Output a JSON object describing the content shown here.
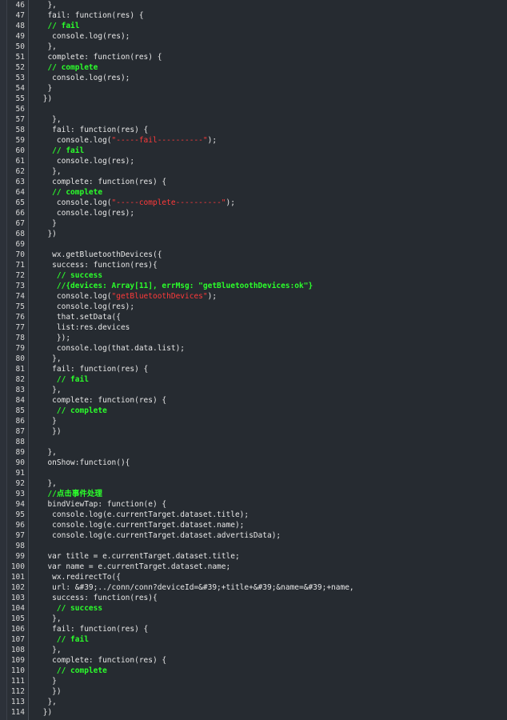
{
  "editor": {
    "lines": [
      {
        "n": "46",
        "segments": [
          {
            "t": "  },",
            "k": "plain"
          }
        ]
      },
      {
        "n": "47",
        "segments": [
          {
            "t": "  fail: function(res) {",
            "k": "plain"
          }
        ]
      },
      {
        "n": "48",
        "segments": [
          {
            "t": "  // fail",
            "k": "cm"
          }
        ]
      },
      {
        "n": "49",
        "segments": [
          {
            "t": "   console.log(res);",
            "k": "plain"
          }
        ]
      },
      {
        "n": "50",
        "segments": [
          {
            "t": "  },",
            "k": "plain"
          }
        ]
      },
      {
        "n": "51",
        "segments": [
          {
            "t": "  complete: function(res) {",
            "k": "plain"
          }
        ]
      },
      {
        "n": "52",
        "segments": [
          {
            "t": "  // complete",
            "k": "cm"
          }
        ]
      },
      {
        "n": "53",
        "segments": [
          {
            "t": "   console.log(res);",
            "k": "plain"
          }
        ]
      },
      {
        "n": "54",
        "segments": [
          {
            "t": "  }",
            "k": "plain"
          }
        ]
      },
      {
        "n": "55",
        "segments": [
          {
            "t": " })",
            "k": "plain"
          }
        ]
      },
      {
        "n": "56",
        "segments": [
          {
            "t": "",
            "k": "plain"
          }
        ]
      },
      {
        "n": "57",
        "segments": [
          {
            "t": "   },",
            "k": "plain"
          }
        ]
      },
      {
        "n": "58",
        "segments": [
          {
            "t": "   fail: function(res) {",
            "k": "plain"
          }
        ]
      },
      {
        "n": "59",
        "segments": [
          {
            "t": "    console.log(",
            "k": "plain"
          },
          {
            "t": "\"-----fail----------\"",
            "k": "str"
          },
          {
            "t": ");",
            "k": "plain"
          }
        ]
      },
      {
        "n": "60",
        "segments": [
          {
            "t": "   // fail",
            "k": "cm"
          }
        ]
      },
      {
        "n": "61",
        "segments": [
          {
            "t": "    console.log(res);",
            "k": "plain"
          }
        ]
      },
      {
        "n": "62",
        "segments": [
          {
            "t": "   },",
            "k": "plain"
          }
        ]
      },
      {
        "n": "63",
        "segments": [
          {
            "t": "   complete: function(res) {",
            "k": "plain"
          }
        ]
      },
      {
        "n": "64",
        "segments": [
          {
            "t": "   // complete",
            "k": "cm"
          }
        ]
      },
      {
        "n": "65",
        "segments": [
          {
            "t": "    console.log(",
            "k": "plain"
          },
          {
            "t": "\"-----complete----------\"",
            "k": "str"
          },
          {
            "t": ");",
            "k": "plain"
          }
        ]
      },
      {
        "n": "66",
        "segments": [
          {
            "t": "    console.log(res);",
            "k": "plain"
          }
        ]
      },
      {
        "n": "67",
        "segments": [
          {
            "t": "   }",
            "k": "plain"
          }
        ]
      },
      {
        "n": "68",
        "segments": [
          {
            "t": "  })",
            "k": "plain"
          }
        ]
      },
      {
        "n": "69",
        "segments": [
          {
            "t": "",
            "k": "plain"
          }
        ]
      },
      {
        "n": "70",
        "segments": [
          {
            "t": "   wx.getBluetoothDevices({",
            "k": "plain"
          }
        ]
      },
      {
        "n": "71",
        "segments": [
          {
            "t": "   success: function(res){",
            "k": "plain"
          }
        ]
      },
      {
        "n": "72",
        "segments": [
          {
            "t": "    // success",
            "k": "cm"
          }
        ]
      },
      {
        "n": "73",
        "segments": [
          {
            "t": "    //{devices: Array[11], errMsg: \"getBluetoothDevices:ok\"}",
            "k": "cm"
          }
        ]
      },
      {
        "n": "74",
        "segments": [
          {
            "t": "    console.log(",
            "k": "plain"
          },
          {
            "t": "\"getBluetoothDevices\"",
            "k": "str"
          },
          {
            "t": ");",
            "k": "plain"
          }
        ]
      },
      {
        "n": "75",
        "segments": [
          {
            "t": "    console.log(res);",
            "k": "plain"
          }
        ]
      },
      {
        "n": "76",
        "segments": [
          {
            "t": "    that.setData({",
            "k": "plain"
          }
        ]
      },
      {
        "n": "77",
        "segments": [
          {
            "t": "    list:res.devices",
            "k": "plain"
          }
        ]
      },
      {
        "n": "78",
        "segments": [
          {
            "t": "    });",
            "k": "plain"
          }
        ]
      },
      {
        "n": "79",
        "segments": [
          {
            "t": "    console.log(that.data.list);",
            "k": "plain"
          }
        ]
      },
      {
        "n": "80",
        "segments": [
          {
            "t": "   },",
            "k": "plain"
          }
        ]
      },
      {
        "n": "81",
        "segments": [
          {
            "t": "   fail: function(res) {",
            "k": "plain"
          }
        ]
      },
      {
        "n": "82",
        "segments": [
          {
            "t": "    // fail",
            "k": "cm"
          }
        ]
      },
      {
        "n": "83",
        "segments": [
          {
            "t": "   },",
            "k": "plain"
          }
        ]
      },
      {
        "n": "84",
        "segments": [
          {
            "t": "   complete: function(res) {",
            "k": "plain"
          }
        ]
      },
      {
        "n": "85",
        "segments": [
          {
            "t": "    // complete",
            "k": "cm"
          }
        ]
      },
      {
        "n": "86",
        "segments": [
          {
            "t": "   }",
            "k": "plain"
          }
        ]
      },
      {
        "n": "87",
        "segments": [
          {
            "t": "   })",
            "k": "plain"
          }
        ]
      },
      {
        "n": "88",
        "segments": [
          {
            "t": "",
            "k": "plain"
          }
        ]
      },
      {
        "n": "89",
        "segments": [
          {
            "t": "  },",
            "k": "plain"
          }
        ]
      },
      {
        "n": "90",
        "segments": [
          {
            "t": "  onShow:function(){",
            "k": "plain"
          }
        ]
      },
      {
        "n": "91",
        "segments": [
          {
            "t": "",
            "k": "plain"
          }
        ]
      },
      {
        "n": "92",
        "segments": [
          {
            "t": "  },",
            "k": "plain"
          }
        ]
      },
      {
        "n": "93",
        "segments": [
          {
            "t": "  //点击事件处理",
            "k": "cm"
          }
        ]
      },
      {
        "n": "94",
        "segments": [
          {
            "t": "  bindViewTap: function(e) {",
            "k": "plain"
          }
        ]
      },
      {
        "n": "95",
        "segments": [
          {
            "t": "   console.log(e.currentTarget.dataset.title);",
            "k": "plain"
          }
        ]
      },
      {
        "n": "96",
        "segments": [
          {
            "t": "   console.log(e.currentTarget.dataset.name);",
            "k": "plain"
          }
        ]
      },
      {
        "n": "97",
        "segments": [
          {
            "t": "   console.log(e.currentTarget.dataset.advertisData);",
            "k": "plain"
          }
        ]
      },
      {
        "n": "98",
        "segments": [
          {
            "t": "",
            "k": "plain"
          }
        ]
      },
      {
        "n": "99",
        "segments": [
          {
            "t": "  var title = e.currentTarget.dataset.title;",
            "k": "plain"
          }
        ]
      },
      {
        "n": "100",
        "segments": [
          {
            "t": "  var name = e.currentTarget.dataset.name;",
            "k": "plain"
          }
        ]
      },
      {
        "n": "101",
        "segments": [
          {
            "t": "   wx.redirectTo({",
            "k": "plain"
          }
        ]
      },
      {
        "n": "102",
        "segments": [
          {
            "t": "   url: &#39;../conn/conn?deviceId=&#39;+title+&#39;&name=&#39;+name,",
            "k": "plain"
          }
        ]
      },
      {
        "n": "103",
        "segments": [
          {
            "t": "   success: function(res){",
            "k": "plain"
          }
        ]
      },
      {
        "n": "104",
        "segments": [
          {
            "t": "    // success",
            "k": "cm"
          }
        ]
      },
      {
        "n": "105",
        "segments": [
          {
            "t": "   },",
            "k": "plain"
          }
        ]
      },
      {
        "n": "106",
        "segments": [
          {
            "t": "   fail: function(res) {",
            "k": "plain"
          }
        ]
      },
      {
        "n": "107",
        "segments": [
          {
            "t": "    // fail",
            "k": "cm"
          }
        ]
      },
      {
        "n": "108",
        "segments": [
          {
            "t": "   },",
            "k": "plain"
          }
        ]
      },
      {
        "n": "109",
        "segments": [
          {
            "t": "   complete: function(res) {",
            "k": "plain"
          }
        ]
      },
      {
        "n": "110",
        "segments": [
          {
            "t": "    // complete",
            "k": "cm"
          }
        ]
      },
      {
        "n": "111",
        "segments": [
          {
            "t": "   }",
            "k": "plain"
          }
        ]
      },
      {
        "n": "112",
        "segments": [
          {
            "t": "   })",
            "k": "plain"
          }
        ]
      },
      {
        "n": "113",
        "segments": [
          {
            "t": "  },",
            "k": "plain"
          }
        ]
      },
      {
        "n": "114",
        "segments": [
          {
            "t": " })",
            "k": "plain"
          }
        ]
      }
    ],
    "colors": {
      "background": "#262b31",
      "gutter": "#2a2f36",
      "comment": "#2bff2b",
      "string": "#ff3a3a",
      "text": "#e8e8e8"
    }
  }
}
